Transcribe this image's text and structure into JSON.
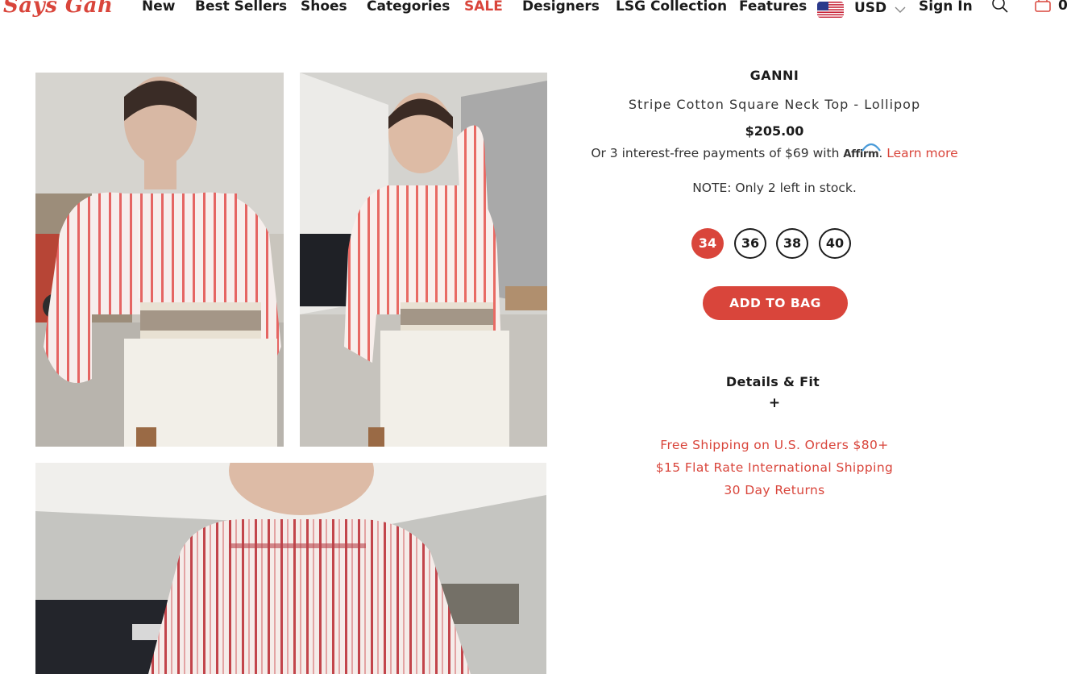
{
  "header": {
    "logo_text": "Says Gah",
    "nav": [
      {
        "label": "New"
      },
      {
        "label": "Best Sellers"
      },
      {
        "label": "Shoes"
      },
      {
        "label": "Categories"
      },
      {
        "label": "SALE"
      },
      {
        "label": "Designers"
      },
      {
        "label": "LSG Collection"
      },
      {
        "label": "Features"
      }
    ],
    "currency": {
      "label": "USD",
      "flag_icon": "us-flag-icon"
    },
    "sign_in_label": "Sign In",
    "search_icon": "search-icon",
    "bag": {
      "icon": "shopping-bag-icon",
      "count": "0"
    }
  },
  "gallery": {
    "images": [
      {
        "name": "product-photo-front"
      },
      {
        "name": "product-photo-side"
      },
      {
        "name": "product-photo-closeup"
      }
    ]
  },
  "product": {
    "brand": "GANNI",
    "title": "Stripe Cotton Square Neck Top - Lollipop",
    "price": "$205.00",
    "affirm": {
      "prefix": "Or 3 interest-free payments of $69 with",
      "logo_text": "Affirm",
      "period": ".",
      "learn_more": "Learn more"
    },
    "stock_note": "NOTE: Only 2 left in stock.",
    "sizes": [
      "34",
      "36",
      "38",
      "40"
    ],
    "selected_size": "34",
    "add_to_bag_label": "ADD TO BAG",
    "details_title": "Details & Fit",
    "details_toggle": "+",
    "perks": [
      "Free Shipping on U.S. Orders $80+",
      "$15 Flat Rate International Shipping",
      "30 Day Returns"
    ]
  },
  "colors": {
    "accent": "#d9453b",
    "text": "#1b1b1b",
    "background": "#ffffff"
  }
}
